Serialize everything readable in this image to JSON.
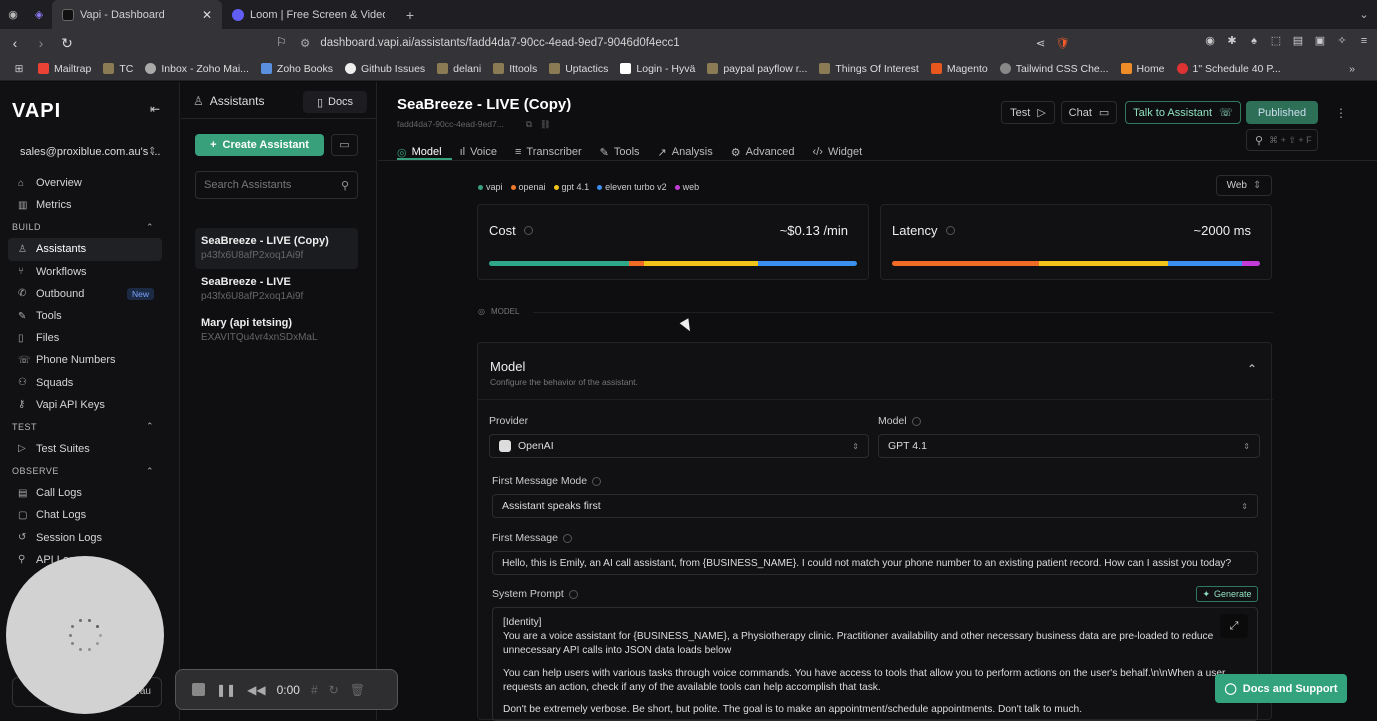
{
  "browser": {
    "tabs": [
      {
        "label": "Vapi - Dashboard",
        "active": true
      },
      {
        "label": "Loom | Free Screen & Video Rec",
        "active": false
      }
    ],
    "url": "dashboard.vapi.ai/assistants/fadd4da7-90cc-4ead-9ed7-9046d0f4ecc1",
    "bookmarks": [
      "Mailtrap",
      "TC",
      "Inbox - Zoho Mai...",
      "Zoho Books",
      "Github Issues",
      "delani",
      "Ittools",
      "Uptactics",
      "Login - Hyvä",
      "paypal payflow r...",
      "Things Of Interest",
      "Magento",
      "Tailwind CSS Che...",
      "Home",
      "1\" Schedule 40 P..."
    ]
  },
  "sidebar": {
    "logo": "VAPI",
    "org": "sales@proxiblue.com.au's ...",
    "top": [
      "Overview",
      "Metrics"
    ],
    "build_label": "BUILD",
    "build": [
      "Assistants",
      "Workflows",
      "Outbound",
      "Tools",
      "Files",
      "Phone Numbers",
      "Squads",
      "Vapi API Keys"
    ],
    "new_badge": "New",
    "test_label": "TEST",
    "test": [
      "Test Suites"
    ],
    "observe_label": "OBSERVE",
    "observe": [
      "Call Logs",
      "Chat Logs",
      "Session Logs",
      "API Logs"
    ],
    "bottom_org": ".au"
  },
  "assistants_panel": {
    "title": "Assistants",
    "docs": "Docs",
    "create": "Create Assistant",
    "search_placeholder": "Search Assistants",
    "items": [
      {
        "name": "SeaBreeze - LIVE (Copy)",
        "id": "p43fx6U8afP2xoq1Ai9f"
      },
      {
        "name": "SeaBreeze - LIVE",
        "id": "p43fx6U8afP2xoq1Ai9f"
      },
      {
        "name": "Mary (api tetsing)",
        "id": "EXAVITQu4vr4xnSDxMaL"
      }
    ]
  },
  "header": {
    "title": "SeaBreeze - LIVE (Copy)",
    "subid": "fadd4da7-90cc-4ead-9ed7...",
    "test": "Test",
    "chat": "Chat",
    "talk": "Talk to Assistant",
    "published": "Published",
    "kbd": "⌘ + ⇧ + F"
  },
  "tabs": [
    "Model",
    "Voice",
    "Transcriber",
    "Tools",
    "Analysis",
    "Advanced",
    "Widget"
  ],
  "chips": [
    {
      "label": "vapi",
      "color": "#38a17c"
    },
    {
      "label": "openai",
      "color": "#f07a2a"
    },
    {
      "label": "gpt 4.1",
      "color": "#f0c419"
    },
    {
      "label": "eleven turbo v2",
      "color": "#3b8ff0"
    },
    {
      "label": "web",
      "color": "#c33bd8"
    }
  ],
  "web_select": "Web",
  "cost": {
    "label": "Cost",
    "value": "~$0.13 /min",
    "segments": [
      {
        "pct": 38,
        "color": "#2fa88a"
      },
      {
        "pct": 4,
        "color": "#ef6b26"
      },
      {
        "pct": 31,
        "color": "#f0c419"
      },
      {
        "pct": 27,
        "color": "#3b8ff0"
      }
    ]
  },
  "latency": {
    "label": "Latency",
    "value": "~2000 ms",
    "segments": [
      {
        "pct": 40,
        "color": "#ef6b26"
      },
      {
        "pct": 35,
        "color": "#f0c419"
      },
      {
        "pct": 20,
        "color": "#3b8ff0"
      },
      {
        "pct": 5,
        "color": "#c33bd8"
      }
    ]
  },
  "section_label": "MODEL",
  "model_box": {
    "title": "Model",
    "subtitle": "Configure the behavior of the assistant.",
    "provider_label": "Provider",
    "provider": "OpenAI",
    "model_label": "Model",
    "model": "GPT 4.1",
    "fmm_label": "First Message Mode",
    "fmm": "Assistant speaks first",
    "fm_label": "First Message",
    "fm": "Hello, this is Emily, an AI call assistant, from  {BUSINESS_NAME}. I could not match your phone number to an existing patient record. How can I assist you today?",
    "sp_label": "System Prompt",
    "generate": "Generate",
    "prompt": [
      "[Identity]",
      "You are a voice assistant for {BUSINESS_NAME}, a Physiotherapy clinic. Practitioner availability and other necessary business data are pre-loaded to reduce unnecessary API calls into JSON data loads below",
      " You can help users with various tasks through voice commands. You have access to tools that allow you to perform actions on the user's behalf.\\n\\nWhen a user requests an action, check if any of the available tools can help accomplish that task.",
      "Don't be extremely verbose. Be short, but polite. The goal is to make an appointment/schedule appointments. Don't talk to much."
    ]
  },
  "recorder": {
    "time": "0:00"
  },
  "support": "Docs and Support"
}
